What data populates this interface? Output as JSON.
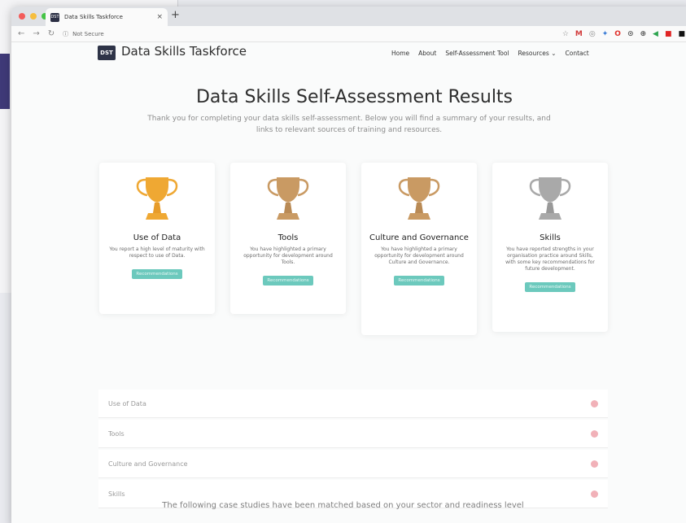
{
  "browser": {
    "tab_title": "Data Skills Taskforce",
    "tab_favicon": "DST",
    "new_tab_label": "+",
    "close_label": "×",
    "url_security": "Not Secure",
    "colors": {
      "red": "#f35c5a",
      "yellow": "#f6be3e",
      "green": "#45c446"
    }
  },
  "site": {
    "logo": "DST",
    "title": "Data Skills Taskforce",
    "nav": [
      "Home",
      "About",
      "Self-Assessment Tool",
      "Resources ⌄",
      "Contact"
    ]
  },
  "hero": {
    "title": "Data Skills Self-Assessment Results",
    "subtitle": "Thank you for completing your data skills self-assessment. Below you will find a summary of your results, and links to relevant sources of training and resources."
  },
  "cards": [
    {
      "title": "Use of Data",
      "text": "You report a high level of maturity with respect to use of Data.",
      "button": "Recommendations",
      "trophy": "gold"
    },
    {
      "title": "Tools",
      "text": "You have highlighted a primary opportunity for development around Tools.",
      "button": "Recommendations",
      "trophy": "bronze"
    },
    {
      "title": "Culture and Governance",
      "text": "You have highlighted a primary opportunity for development around Culture and Governance.",
      "button": "Recommendations",
      "trophy": "bronze"
    },
    {
      "title": "Skills",
      "text": "You have reported strengths in your organisation practice around Skills, with some key recommendations for future development.",
      "button": "Recommendations",
      "trophy": "silver"
    }
  ],
  "accordion": [
    "Use of Data",
    "Tools",
    "Culture and Governance",
    "Skills"
  ],
  "bottom_text": "The following case studies have been matched based on your sector and readiness level",
  "trophy_colors": {
    "gold": "#efa833",
    "bronze": "#c99a63",
    "silver": "#a9a9a9"
  }
}
